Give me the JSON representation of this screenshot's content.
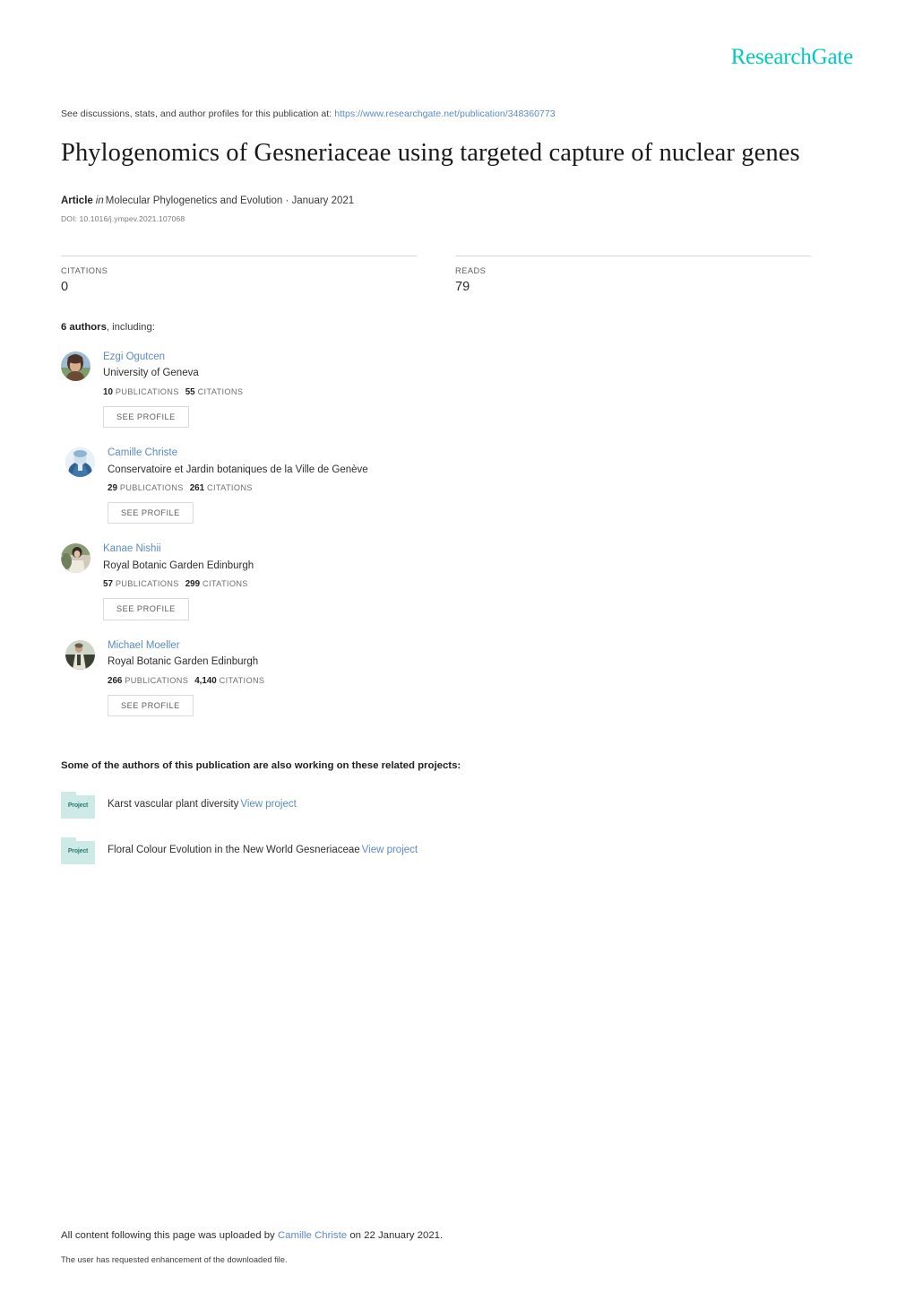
{
  "brand": {
    "logo_text": "ResearchGate",
    "accent_color": "#00ccbb",
    "link_color": "#5b8ac6"
  },
  "header": {
    "discussions_prefix": "See discussions, stats, and author profiles for this publication at:",
    "discussions_url": "https://www.researchgate.net/publication/348360773"
  },
  "publication": {
    "title": "Phylogenomics of Gesneriaceae using targeted capture of nuclear genes",
    "type_label": "Article",
    "in_label": "in",
    "venue": "Molecular Phylogenetics and Evolution · January 2021",
    "doi": "DOI: 10.1016/j.ympev.2021.107068"
  },
  "stats": {
    "citations": {
      "label": "CITATIONS",
      "value": "0"
    },
    "reads": {
      "label": "READS",
      "value": "79"
    }
  },
  "authors_section": {
    "count_text": "6 authors",
    "count_suffix": ", including:",
    "see_profile_label": "SEE PROFILE",
    "publications_label": "PUBLICATIONS",
    "citations_label": "CITATIONS",
    "authors": [
      {
        "name": "Ezgi Ogutcen",
        "affiliation": "University of Geneva",
        "publications": "10",
        "citations": "55",
        "avatar_colors": [
          "#8aa6c0",
          "#6b4b35",
          "#d6b49a"
        ]
      },
      {
        "name": "Camille Christe",
        "affiliation": "Conservatoire et Jardin botaniques de la Ville de Genève",
        "publications": "29",
        "citations": "261",
        "avatar_colors": [
          "#cfe3f2",
          "#2d5f8f",
          "#9cc3e0"
        ]
      },
      {
        "name": "Kanae Nishii",
        "affiliation": "Royal Botanic Garden Edinburgh",
        "publications": "57",
        "citations": "299",
        "avatar_colors": [
          "#6f7f5c",
          "#2f2a24",
          "#c9c3b4"
        ]
      },
      {
        "name": "Michael Moeller",
        "affiliation": "Royal Botanic Garden Edinburgh",
        "publications": "266",
        "citations": "4,140",
        "avatar_colors": [
          "#8f9a86",
          "#3a4133",
          "#d9d4c6"
        ]
      }
    ]
  },
  "projects_section": {
    "heading": "Some of the authors of this publication are also working on these related projects:",
    "icon_label": "Project",
    "view_label": "View project",
    "projects": [
      {
        "title": "Karst vascular plant diversity"
      },
      {
        "title": "Floral Colour Evolution in the New World Gesneriaceae"
      }
    ]
  },
  "footer": {
    "upload_prefix": "All content following this page was uploaded by",
    "uploader": "Camille Christe",
    "upload_suffix": "on 22 January 2021.",
    "enhancement_note": "The user has requested enhancement of the downloaded file."
  }
}
